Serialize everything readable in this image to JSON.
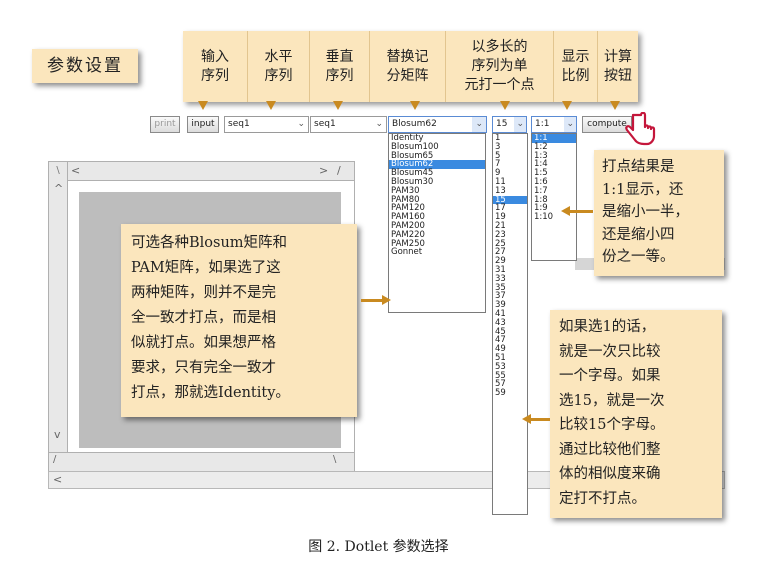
{
  "title_label": "参数设置",
  "header_cells": [
    "输入\n序列",
    "水平\n序列",
    "垂直\n序列",
    "替换记\n分矩阵",
    "以多长的\n序列为单\n元打一个点",
    "显示\n比例",
    "计算\n按钮"
  ],
  "toolbar": {
    "print_label": "print",
    "input_label": "input",
    "seq_h": "seq1",
    "seq_v": "seq1",
    "matrix": "Blosum62",
    "window": "15",
    "scale": "1:1",
    "compute_label": "compute"
  },
  "matrix_options": [
    "Identity",
    "Blosum100",
    "Blosum65",
    "Blosum62",
    "Blosum45",
    "Blosum30",
    "PAM30",
    "PAM80",
    "PAM120",
    "PAM160",
    "PAM200",
    "PAM220",
    "PAM250",
    "Gonnet"
  ],
  "matrix_selected": "Blosum62",
  "window_options": [
    "1",
    "3",
    "5",
    "7",
    "9",
    "11",
    "13",
    "15",
    "17",
    "19",
    "21",
    "23",
    "25",
    "27",
    "29",
    "31",
    "33",
    "35",
    "37",
    "39",
    "41",
    "43",
    "45",
    "47",
    "49",
    "51",
    "53",
    "55",
    "57",
    "59"
  ],
  "window_selected": "15",
  "scale_options": [
    "1:1",
    "1:2",
    "1:3",
    "1:4",
    "1:5",
    "1:6",
    "1:7",
    "1:8",
    "1:9",
    "1:10"
  ],
  "scale_selected": "1:1",
  "notes": {
    "scale": "打点结果是\n1:1显示，还\n是缩小一半，\n还是缩小四\n份之一等。",
    "matrix": "可选各种Blosum矩阵和\nPAM矩阵，如果选了这\n两种矩阵，则并不是完\n全一致才打点，而是相\n似就打点。如果想严格\n要求，只有完全一致才\n打点，那就选Identity。",
    "window": "如果选1的话，\n就是一次只比较\n一个字母。如果\n选15，就是一次\n比较15个字母。\n通过比较他们整\n体的相似度来确\n定打不打点。"
  },
  "scroll_glyphs": {
    "left": "<",
    "right": ">",
    "up": "^",
    "down": "v",
    "slash": "/",
    "backslash": "\\"
  },
  "caption": "图 2. Dotlet 参数选择",
  "colors": {
    "note_bg": "#fbe6bd",
    "arrow": "#c98a20",
    "highlight": "#3a8ae0",
    "panel": "#bdbdbd"
  }
}
